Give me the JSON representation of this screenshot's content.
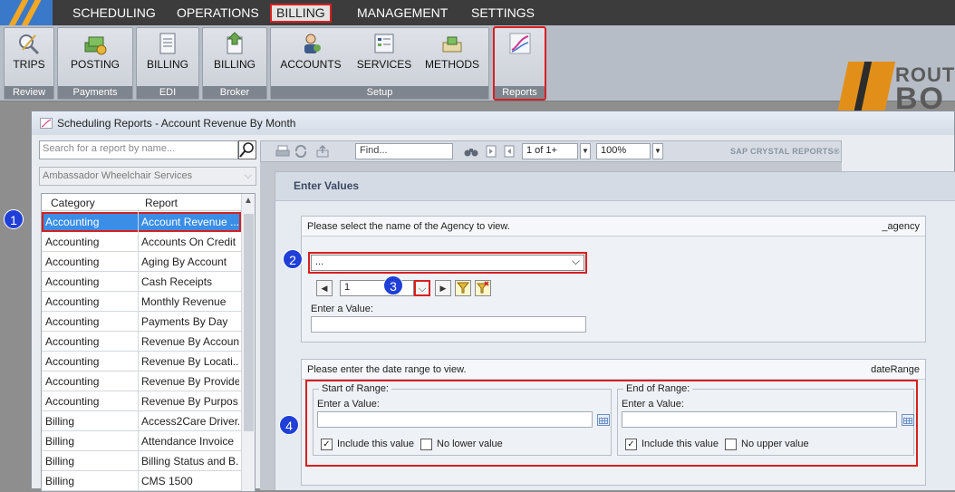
{
  "menu": [
    "SCHEDULING",
    "OPERATIONS",
    "BILLING",
    "MANAGEMENT",
    "SETTINGS"
  ],
  "ribbon": {
    "groups": [
      {
        "label": "Review",
        "buttons": [
          "TRIPS"
        ]
      },
      {
        "label": "Payments",
        "buttons": [
          "POSTING"
        ]
      },
      {
        "label": "EDI",
        "buttons": [
          "BILLING"
        ]
      },
      {
        "label": "Broker",
        "buttons": [
          "BILLING"
        ]
      },
      {
        "label": "Setup",
        "buttons": [
          "ACCOUNTS",
          "SERVICES",
          "METHODS"
        ]
      },
      {
        "label": "Reports",
        "buttons": []
      }
    ]
  },
  "brand": {
    "line1": "ROUT",
    "line2": "BO"
  },
  "window": {
    "title": "Scheduling Reports - Account Revenue By Month"
  },
  "left": {
    "search_placeholder": "Search for a report by name...",
    "agency": "Ambassador Wheelchair Services",
    "columns": [
      "Category",
      "Report"
    ],
    "rows": [
      [
        "Accounting",
        "Account Revenue ..."
      ],
      [
        "Accounting",
        "Accounts On Credit ..."
      ],
      [
        "Accounting",
        "Aging By Account"
      ],
      [
        "Accounting",
        "Cash Receipts"
      ],
      [
        "Accounting",
        "Monthly Revenue"
      ],
      [
        "Accounting",
        "Payments By Day"
      ],
      [
        "Accounting",
        "Revenue By Account"
      ],
      [
        "Accounting",
        "Revenue By Locati..."
      ],
      [
        "Accounting",
        "Revenue By Provider"
      ],
      [
        "Accounting",
        "Revenue By Purpos..."
      ],
      [
        "Billing",
        "Access2Care Driver..."
      ],
      [
        "Billing",
        "Attendance Invoice"
      ],
      [
        "Billing",
        "Billing Status and B..."
      ],
      [
        "Billing",
        "CMS 1500"
      ]
    ]
  },
  "viewer": {
    "find_placeholder": "Find...",
    "page": "1 of 1+",
    "zoom": "100%",
    "brand": "SAP CRYSTAL REPORTS®",
    "enter_values": "Enter Values",
    "agency_param": {
      "prompt": "Please select the name of the Agency to view.",
      "name": "_agency",
      "dropdown": "...",
      "page_value": "1",
      "enter_label": "Enter a Value:"
    },
    "date_param": {
      "prompt": "Please enter the date range to view.",
      "name": "dateRange",
      "start": {
        "legend": "Start of Range:",
        "enter_label": "Enter a Value:",
        "include": "Include this value",
        "none": "No lower value"
      },
      "end": {
        "legend": "End of Range:",
        "enter_label": "Enter a Value:",
        "include": "Include this value",
        "none": "No upper value"
      }
    }
  },
  "callouts": [
    "1",
    "2",
    "3",
    "4"
  ],
  "colors": {
    "accent_red": "#d62020",
    "selection": "#3a8ee6",
    "callout": "#1f3fd7",
    "brand_orange": "#e28f1a"
  }
}
